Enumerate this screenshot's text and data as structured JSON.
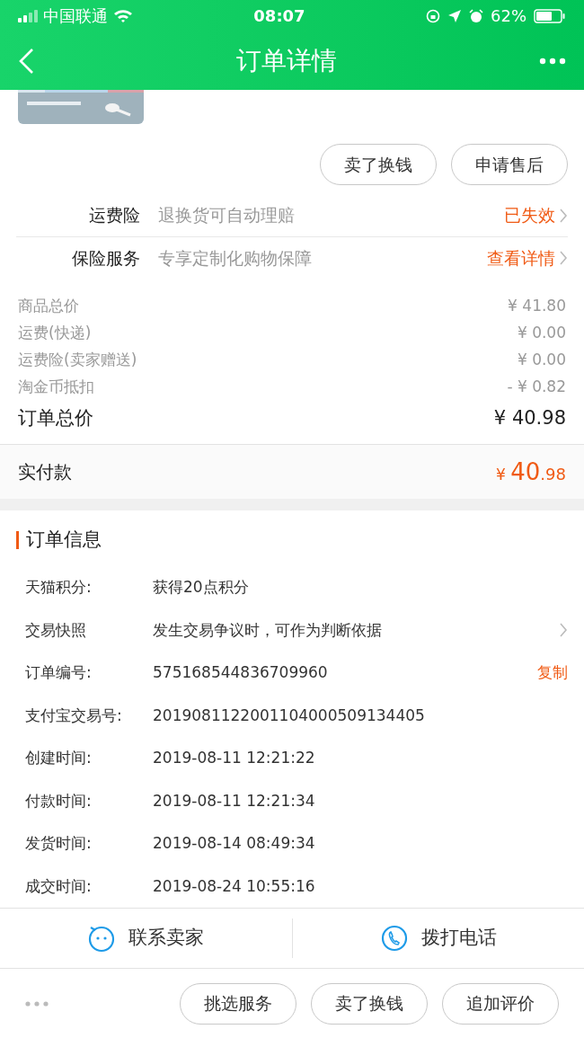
{
  "status_bar": {
    "carrier": "中国联通",
    "time": "08:07",
    "battery": "62%"
  },
  "header": {
    "title": "订单详情"
  },
  "product": {
    "kind": "picture"
  },
  "item_actions": [
    "卖了换钱",
    "申请售后"
  ],
  "services": [
    {
      "label": "运费险",
      "desc": "退换货可自动理赔",
      "status": "已失效"
    },
    {
      "label": "保险服务",
      "desc": "专享定制化购物保障",
      "status": "查看详情"
    }
  ],
  "price_rows": [
    {
      "label": "商品总价",
      "value": "¥ 41.80"
    },
    {
      "label": "运费(快递)",
      "value": "¥ 0.00"
    },
    {
      "label": "运费险(卖家赠送)",
      "value": "¥ 0.00"
    },
    {
      "label": "淘金币抵扣",
      "value": "- ¥ 0.82"
    }
  ],
  "order_total": {
    "label": "订单总价",
    "value": "¥ 40.98"
  },
  "paid": {
    "label": "实付款",
    "currency": "¥",
    "integer": "40",
    "decimal": ".98"
  },
  "order_info": {
    "title": "订单信息",
    "rows": [
      {
        "label": "天猫积分:",
        "value": "获得20点积分",
        "chevron": false
      },
      {
        "label": "交易快照",
        "value": "发生交易争议时，可作为判断依据",
        "chevron": true
      },
      {
        "label": "订单编号:",
        "value": "575168544836709960",
        "action": "复制",
        "chevron": false
      },
      {
        "label": "支付宝交易号:",
        "value": "2019081122001104000509134405",
        "chevron": false
      },
      {
        "label": "创建时间:",
        "value": "2019-08-11 12:21:22",
        "chevron": false
      },
      {
        "label": "付款时间:",
        "value": "2019-08-11 12:21:34",
        "chevron": false
      },
      {
        "label": "发货时间:",
        "value": "2019-08-14 08:49:34",
        "chevron": false
      },
      {
        "label": "成交时间:",
        "value": "2019-08-24 10:55:16",
        "chevron": false
      }
    ]
  },
  "contact": [
    {
      "kind": "chat",
      "label": "联系卖家"
    },
    {
      "kind": "phone",
      "label": "拨打电话"
    }
  ],
  "bottom_actions": [
    "挑选服务",
    "卖了换钱",
    "追加评价"
  ]
}
